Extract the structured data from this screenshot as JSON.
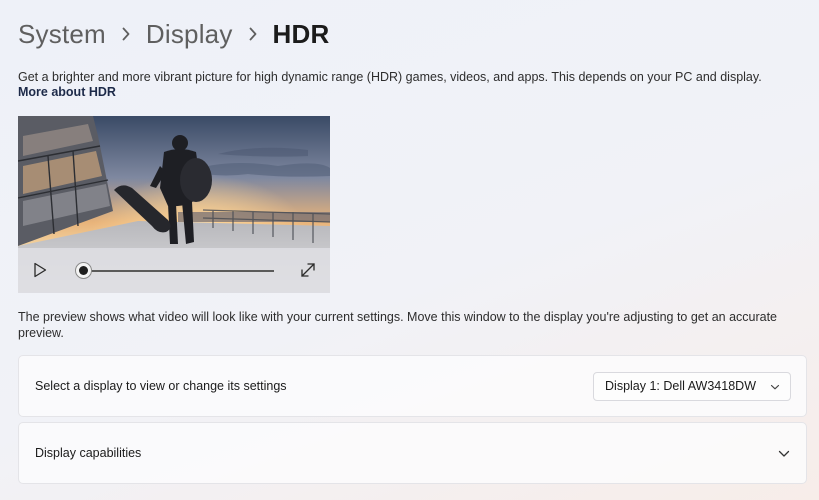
{
  "breadcrumb": {
    "items": [
      "System",
      "Display",
      "HDR"
    ]
  },
  "description": {
    "text": "Get a brighter and more vibrant picture for high dynamic range (HDR) games, videos, and apps. This depends on your PC and display.",
    "link": "More about HDR"
  },
  "video": {
    "progress": 0.0
  },
  "preview_note": "The preview shows what video will look like with your current settings. Move this window to the display you're adjusting to get an accurate preview.",
  "display_select": {
    "label": "Select a display to view or change its settings",
    "selected": "Display 1: Dell AW3418DW"
  },
  "capabilities": {
    "label": "Display capabilities"
  },
  "icons": {
    "breadcrumb_separator": "chevron-right-icon",
    "play": "play-icon",
    "fullscreen": "expand-icon",
    "dropdown": "chevron-down-icon",
    "expander": "chevron-down-icon"
  }
}
